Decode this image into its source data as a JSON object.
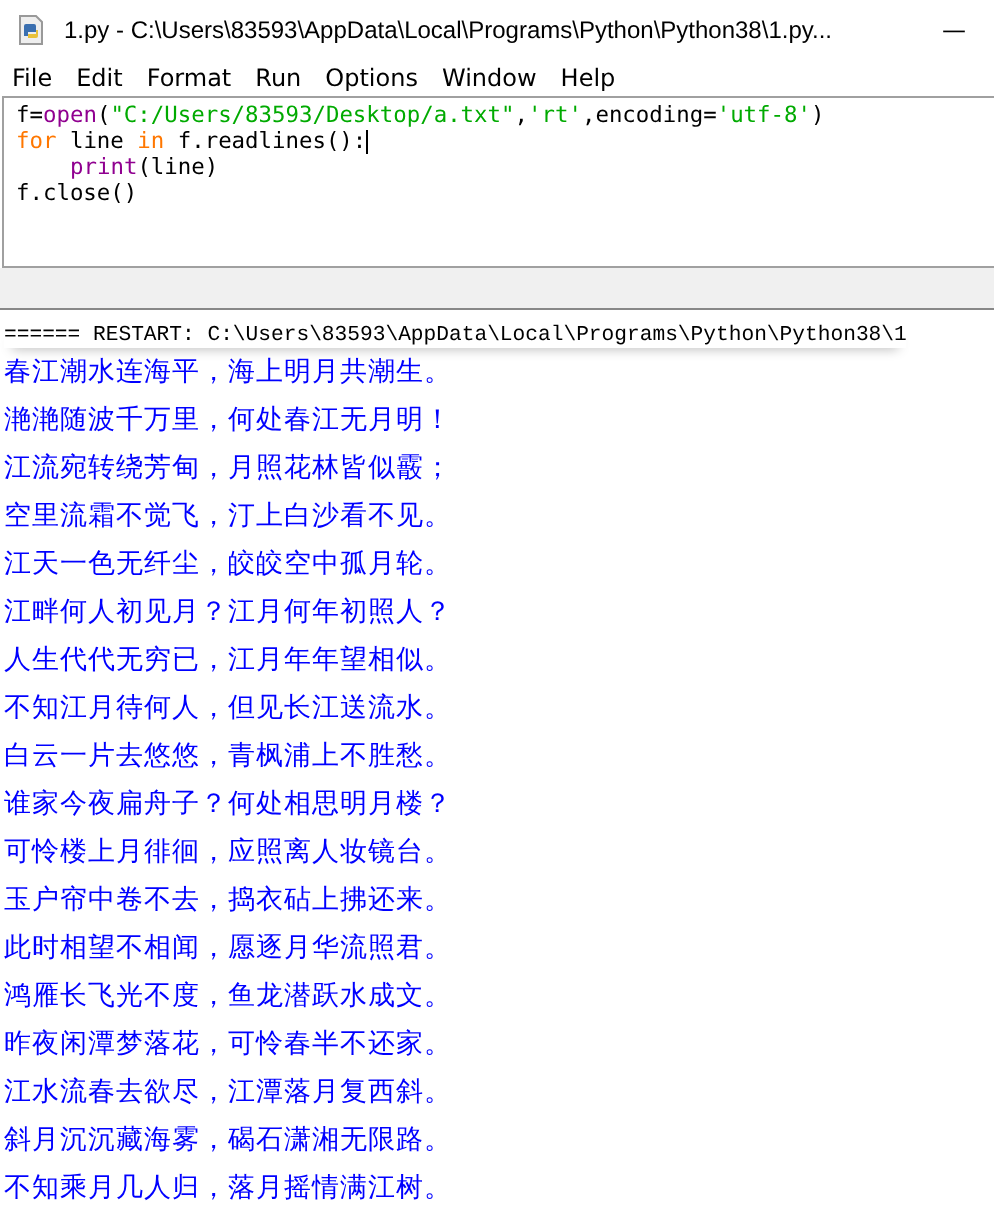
{
  "window": {
    "title": "1.py - C:\\Users\\83593\\AppData\\Local\\Programs\\Python\\Python38\\1.py...",
    "minimize": "—"
  },
  "menu": [
    "File",
    "Edit",
    "Format",
    "Run",
    "Options",
    "Window",
    "Help"
  ],
  "editor": {
    "lines": [
      {
        "cursor": false,
        "tokens": [
          {
            "kind": "plain",
            "text": "f="
          },
          {
            "kind": "builtin",
            "text": "open"
          },
          {
            "kind": "plain",
            "text": "("
          },
          {
            "kind": "string",
            "text": "\"C:/Users/83593/Desktop/a.txt\""
          },
          {
            "kind": "plain",
            "text": ","
          },
          {
            "kind": "string",
            "text": "'rt'"
          },
          {
            "kind": "plain",
            "text": ",encoding="
          },
          {
            "kind": "string",
            "text": "'utf-8'"
          },
          {
            "kind": "plain",
            "text": ")"
          }
        ]
      },
      {
        "cursor": true,
        "tokens": [
          {
            "kind": "keyword",
            "text": "for"
          },
          {
            "kind": "plain",
            "text": " line "
          },
          {
            "kind": "keyword",
            "text": "in"
          },
          {
            "kind": "plain",
            "text": " f.readlines():"
          }
        ]
      },
      {
        "cursor": false,
        "indented": true,
        "tokens": [
          {
            "kind": "builtin",
            "text": "print"
          },
          {
            "kind": "plain",
            "text": "(line)"
          }
        ]
      },
      {
        "cursor": false,
        "tokens": [
          {
            "kind": "plain",
            "text": "f.close()"
          }
        ]
      }
    ]
  },
  "output": {
    "restart": "====== RESTART: C:\\Users\\83593\\AppData\\Local\\Programs\\Python\\Python38\\1",
    "lines": [
      "春江潮水连海平，海上明月共潮生。",
      "滟滟随波千万里，何处春江无月明！",
      "江流宛转绕芳甸，月照花林皆似霰；",
      "空里流霜不觉飞，汀上白沙看不见。",
      "江天一色无纤尘，皎皎空中孤月轮。",
      "江畔何人初见月？江月何年初照人？",
      "人生代代无穷已，江月年年望相似。",
      "不知江月待何人，但见长江送流水。",
      "白云一片去悠悠，青枫浦上不胜愁。",
      "谁家今夜扁舟子？何处相思明月楼？",
      "可怜楼上月徘徊，应照离人妆镜台。",
      "玉户帘中卷不去，捣衣砧上拂还来。",
      "此时相望不相闻，愿逐月华流照君。",
      "鸿雁长飞光不度，鱼龙潜跃水成文。",
      "昨夜闲潭梦落花，可怜春半不还家。",
      "江水流春去欲尽，江潭落月复西斜。",
      "斜月沉沉藏海雾，碣石潇湘无限路。",
      "不知乘月几人归，落月摇情满江树。"
    ]
  }
}
